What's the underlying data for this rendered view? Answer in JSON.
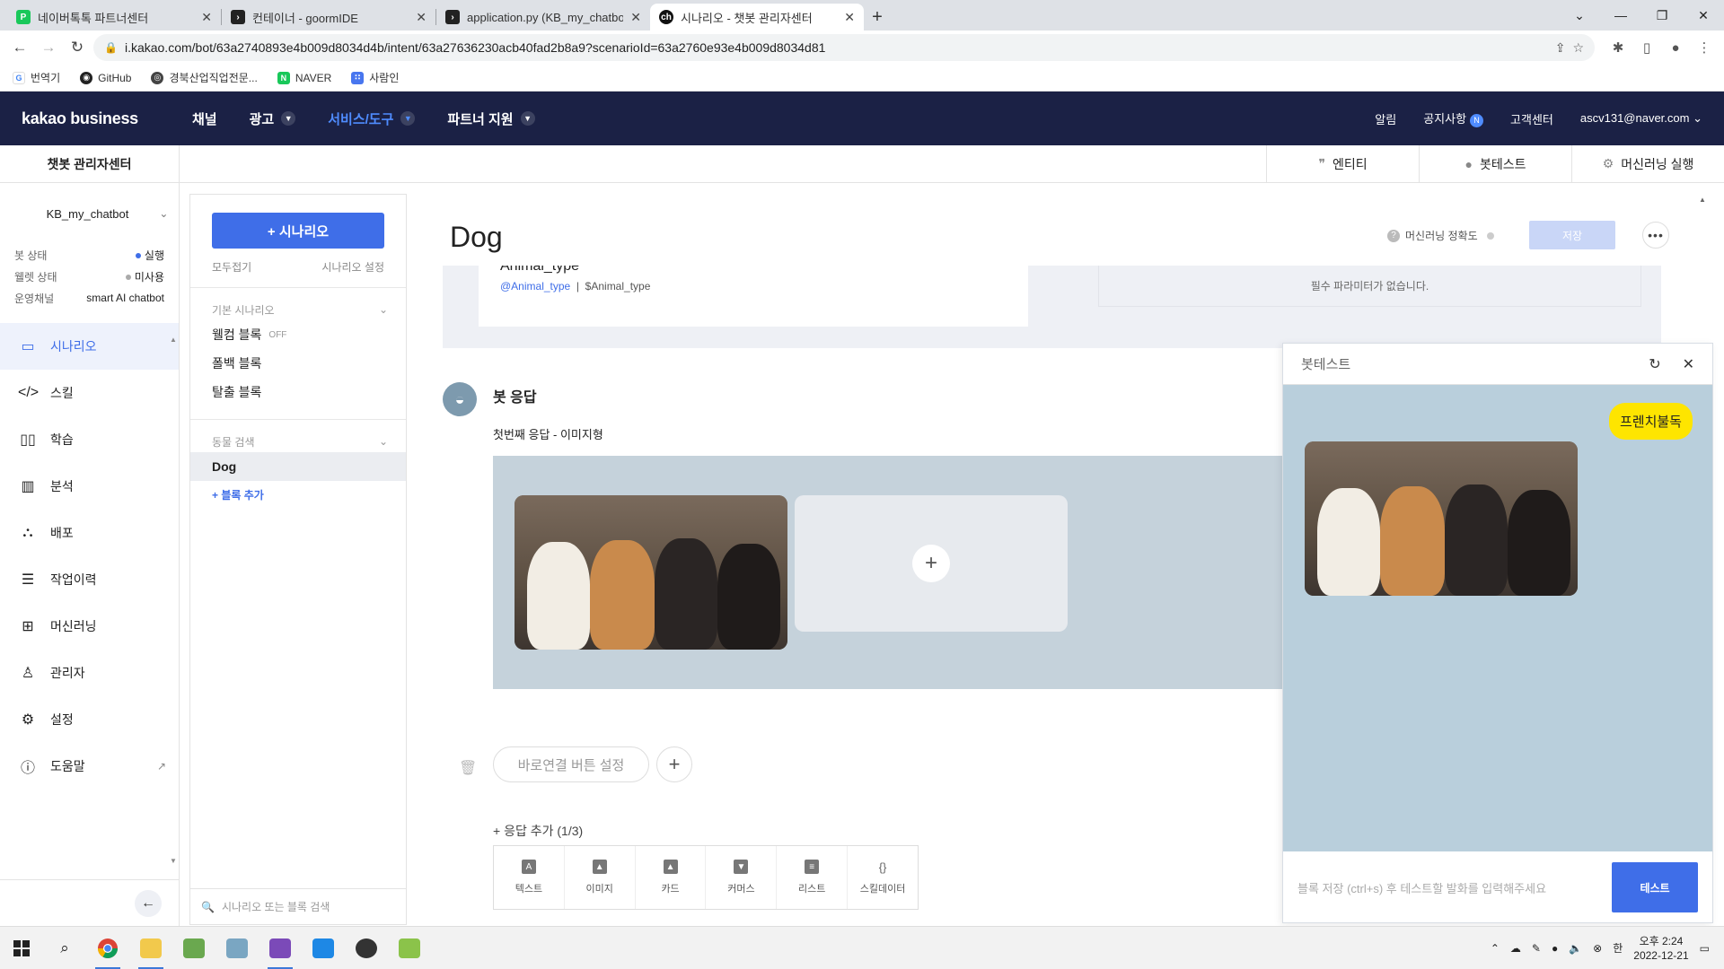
{
  "browser": {
    "tabs": [
      {
        "title": "네이버톡톡 파트너센터",
        "favicon": "naver-talk-icon",
        "color": "#19c85a",
        "active": false
      },
      {
        "title": "컨테이너 - goormIDE",
        "favicon": "terminal-icon",
        "color": "#222222",
        "active": false
      },
      {
        "title": "application.py (KB_my_chatbot_...",
        "favicon": "terminal-icon",
        "color": "#222222",
        "active": false
      },
      {
        "title": "시나리오 - 챗봇 관리자센터",
        "favicon": "kakao-chatbot-icon",
        "color": "#111111",
        "active": true
      }
    ],
    "url": "i.kakao.com/bot/63a2740893e4b009d8034d4b/intent/63a27636230acb40fad2b8a9?scenarioId=63a2760e93e4b009d8034d81",
    "bookmarks": [
      {
        "label": "번역기",
        "icon": "google-icon",
        "color": "#4285f4"
      },
      {
        "label": "GitHub",
        "icon": "github-icon",
        "color": "#222222"
      },
      {
        "label": "경북산업직업전문...",
        "icon": "globe-icon",
        "color": "#444444"
      },
      {
        "label": "NAVER",
        "icon": "naver-icon",
        "color": "#19c85a"
      },
      {
        "label": "사람인",
        "icon": "saramin-icon",
        "color": "#4876ef"
      }
    ]
  },
  "header": {
    "logo": "kakao business",
    "nav": [
      {
        "label": "채널",
        "dropdown": false,
        "active": false
      },
      {
        "label": "광고",
        "dropdown": true,
        "active": false
      },
      {
        "label": "서비스/도구",
        "dropdown": true,
        "active": true
      },
      {
        "label": "파트너 지원",
        "dropdown": true,
        "active": false
      }
    ],
    "right": {
      "alert": "알림",
      "notice": "공지사항",
      "notice_badge": "N",
      "support": "고객센터",
      "account": "ascv131@naver.com"
    }
  },
  "subheader": {
    "title": "챗봇 관리자센터",
    "tools": [
      {
        "label": "엔티티",
        "icon": "quote-icon"
      },
      {
        "label": "봇테스트",
        "icon": "chat-bubble-icon"
      },
      {
        "label": "머신러닝 실행",
        "icon": "gear-icon"
      }
    ]
  },
  "sidebar": {
    "bot_name": "KB_my_chatbot",
    "info": [
      {
        "key": "봇 상태",
        "value": "실행",
        "dot": "blue"
      },
      {
        "key": "웰렛 상태",
        "value": "미사용",
        "dot": "grey"
      },
      {
        "key": "운영채널",
        "value": "smart AI chatbot",
        "dot": ""
      }
    ],
    "menu": [
      {
        "label": "시나리오",
        "icon": "scenario-icon",
        "glyph": "▭",
        "active": true
      },
      {
        "label": "스킬",
        "icon": "code-icon",
        "glyph": "</>",
        "active": false
      },
      {
        "label": "학습",
        "icon": "book-icon",
        "glyph": "📖",
        "active": false
      },
      {
        "label": "분석",
        "icon": "bar-chart-icon",
        "glyph": "▥",
        "active": false
      },
      {
        "label": "배포",
        "icon": "deploy-icon",
        "glyph": "⛬",
        "active": false
      },
      {
        "label": "작업이력",
        "icon": "history-icon",
        "glyph": "☰",
        "active": false
      },
      {
        "label": "머신러닝",
        "icon": "chip-icon",
        "glyph": "⚙",
        "active": false
      },
      {
        "label": "관리자",
        "icon": "admin-icon",
        "glyph": "👤",
        "active": false
      },
      {
        "label": "설정",
        "icon": "settings-icon",
        "glyph": "⚙",
        "active": false
      },
      {
        "label": "도움말",
        "icon": "help-icon",
        "glyph": "?",
        "active": false
      }
    ]
  },
  "scenario_panel": {
    "add_button": "+ 시나리오",
    "collapse_all": "모두접기",
    "scenario_settings": "시나리오 설정",
    "sections": [
      {
        "title": "기본 시나리오",
        "items": [
          {
            "label": "웰컴 블록",
            "badge": "OFF",
            "active": false
          },
          {
            "label": "폴백 블록",
            "badge": "",
            "active": false
          },
          {
            "label": "탈출 블록",
            "badge": "",
            "active": false
          }
        ]
      },
      {
        "title": "동물 검색",
        "items": [
          {
            "label": "Dog",
            "badge": "",
            "active": true
          }
        ]
      }
    ],
    "add_block": "+ 블록 추가",
    "search_placeholder": "시나리오 또는 블록 검색"
  },
  "editor": {
    "block_title": "Dog",
    "ml_accuracy": "머신러닝 정확도",
    "save": "저장",
    "param": {
      "name": "Animal_type",
      "entity": "@Animal_type",
      "variable": "$Animal_type"
    },
    "required_param_msg": "필수 파라미터가 없습니다.",
    "bot_response_title": "봇 응답",
    "first_response": "첫번째 응답 - 이미지형",
    "quick_link_button": "바로연결 버튼 설정",
    "add_response": "+ 응답 추가 (1/3)",
    "response_types": [
      {
        "label": "텍스트",
        "glyph": "A"
      },
      {
        "label": "이미지",
        "glyph": "▲"
      },
      {
        "label": "카드",
        "glyph": "▲"
      },
      {
        "label": "커머스",
        "glyph": "▼"
      },
      {
        "label": "리스트",
        "glyph": "≡"
      },
      {
        "label": "스킬데이터",
        "glyph": "{}"
      }
    ]
  },
  "bot_test": {
    "title": "봇테스트",
    "user_message": "프렌치불독",
    "input_placeholder": "블록 저장 (ctrl+s) 후 테스트할 발화를 입력해주세요",
    "test_button": "테스트"
  },
  "taskbar": {
    "apps": [
      {
        "name": "windows-start-icon",
        "color": "#222222"
      },
      {
        "name": "search-icon",
        "color": "#222222"
      },
      {
        "name": "chrome-icon",
        "color": "#db4437"
      },
      {
        "name": "file-explorer-icon",
        "color": "#f2c94c"
      },
      {
        "name": "notepad-plus-icon",
        "color": "#6aa84f"
      },
      {
        "name": "paint-icon",
        "color": "#7aa6c2"
      },
      {
        "name": "visual-studio-icon",
        "color": "#7b4ab8"
      },
      {
        "name": "vscode-icon",
        "color": "#1e88e5"
      },
      {
        "name": "obs-icon",
        "color": "#333333"
      },
      {
        "name": "tool-icon",
        "color": "#8bc34a"
      }
    ],
    "time": "오후 2:24",
    "date": "2022-12-21",
    "ime": "한"
  }
}
